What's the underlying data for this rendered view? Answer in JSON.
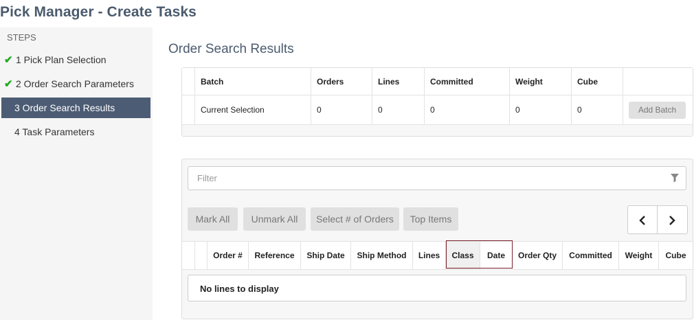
{
  "page_title": "Pick Manager - Create Tasks",
  "steps": {
    "heading": "STEPS",
    "items": [
      {
        "label": "1 Pick Plan Selection",
        "completed": true
      },
      {
        "label": "2 Order Search Parameters",
        "completed": true
      },
      {
        "label": "3 Order Search Results",
        "completed": false,
        "active": true
      },
      {
        "label": "4 Task Parameters",
        "completed": false
      }
    ]
  },
  "section_title": "Order Search Results",
  "batch_table": {
    "headers": [
      "Batch",
      "Orders",
      "Lines",
      "Committed",
      "Weight",
      "Cube"
    ],
    "row": [
      "Current Selection",
      "0",
      "0",
      "0",
      "0",
      "0"
    ],
    "add_batch_label": "Add Batch"
  },
  "orders": {
    "filter_placeholder": "Filter",
    "buttons": {
      "mark_all": "Mark All",
      "unmark_all": "Unmark All",
      "select_n": "Select # of Orders",
      "top_items": "Top Items"
    },
    "pager": {
      "prev": "‹",
      "next": "›"
    },
    "columns": [
      "Order #",
      "Reference",
      "Ship Date",
      "Ship Method",
      "Lines",
      "Class",
      "Date",
      "Order Qty",
      "Committed",
      "Weight",
      "Cube"
    ],
    "empty_message": "No lines to display"
  },
  "colors": {
    "accent": "#4c5c74",
    "check": "#22aa22",
    "highlight_border": "#7b1f2a"
  }
}
